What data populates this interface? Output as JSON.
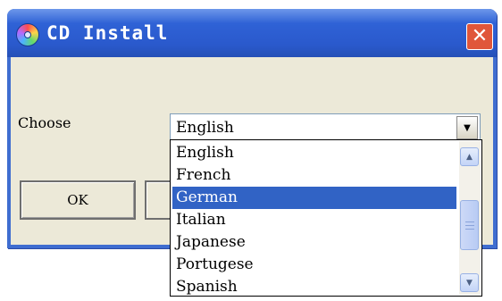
{
  "window": {
    "title": "CD Install",
    "close_symbol": "✕",
    "icon": "cd-disc-icon",
    "accent_color": "#2f62d6"
  },
  "form": {
    "choose_label": "Choose",
    "language_value": "English",
    "dropdown_arrow": "▼"
  },
  "buttons": {
    "ok_label": "OK"
  },
  "dropdown": {
    "items": [
      "English",
      "French",
      "German",
      "Italian",
      "Japanese",
      "Portugese",
      "Spanish"
    ],
    "selected": "German",
    "scroll_up": "▲",
    "scroll_down": "▼"
  }
}
